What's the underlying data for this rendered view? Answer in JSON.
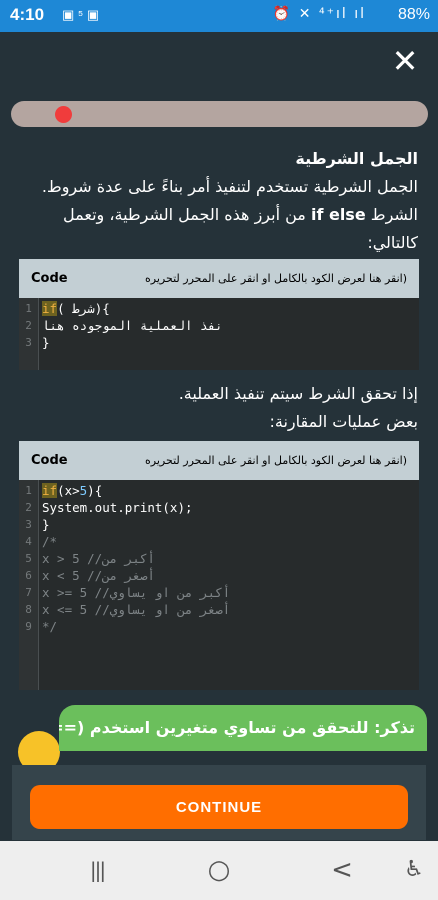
{
  "status_bar": {
    "time": "4:10",
    "left_icons": "▣ ⁵ ▣",
    "right_icons": "⏰ ✕ ⁴⁺ıl ıl",
    "battery": "88%"
  },
  "header": {
    "close_symbol": "✕"
  },
  "progress": {
    "value": 0.05
  },
  "lesson": {
    "title": "الجمل الشرطية",
    "intro_line1": "الجمل الشرطية تستخدم لتنفيذ أمر بناءً على عدة شروط.",
    "intro_line2_pre": "الشرط ",
    "intro_line2_bold": "if else",
    "intro_line2_post": " من أبرز هذه الجمل الشرطية، وتعمل",
    "intro_line3": "كالتالي:",
    "middle_line1": "إذا تحقق الشرط سيتم تنفيذ العملية.",
    "middle_line2": "بعض عمليات المقارنة:"
  },
  "code_block_1": {
    "label": "Code",
    "hint": "(انقر هنا لعرض الكود بالكامل او انقر على المحرر لتحريره",
    "lines": [
      {
        "num": "1",
        "kw": "if",
        "rest": "( شرط){"
      },
      {
        "num": "2",
        "text": "نفذ العملية الموجوده هنا"
      },
      {
        "num": "3",
        "text": "}"
      }
    ]
  },
  "code_block_2": {
    "label": "Code",
    "hint": "(انقر هنا لعرض الكود بالكامل او انقر على المحرر لتحريره",
    "lines": [
      {
        "num": "1",
        "kw": "if",
        "pre": "(x>",
        "n": "5",
        "post": "){"
      },
      {
        "num": "2",
        "text": "System.out.print(x);"
      },
      {
        "num": "3",
        "text": "}"
      },
      {
        "num": "4",
        "text": "/*"
      },
      {
        "num": "5",
        "text": "x > 5 //أكبر من"
      },
      {
        "num": "6",
        "text": "x < 5 //أصغر من"
      },
      {
        "num": "7",
        "text": "x >= 5 //أكبر من او يساوي"
      },
      {
        "num": "8",
        "text": "x <= 5 //أصغر من او يساوي"
      },
      {
        "num": "9",
        "text": "*/"
      }
    ]
  },
  "reminder": {
    "text": "تذكر: للتحقق من تساوي متغيرين استخدم (==)"
  },
  "continue_button": {
    "label": "CONTINUE"
  },
  "nav_bar": {
    "recents": "|||",
    "home": "○",
    "back": "<",
    "accessibility": "♿"
  },
  "colors": {
    "accent": "#ff6e00",
    "status_bar": "#1e88d6",
    "background": "#253239",
    "reminder": "#6bbf5c"
  }
}
